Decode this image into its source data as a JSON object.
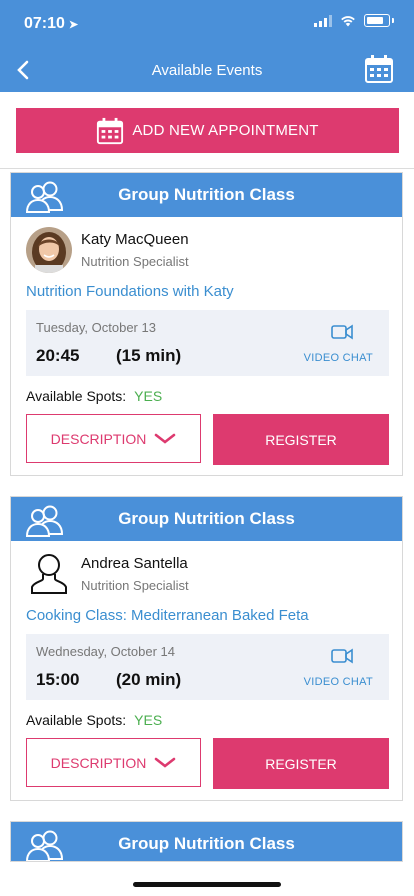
{
  "status_bar": {
    "time": "07:10"
  },
  "nav": {
    "title": "Available Events"
  },
  "add_button": {
    "label": "ADD NEW APPOINTMENT"
  },
  "events": [
    {
      "category": "Group Nutrition Class",
      "instructor": "Katy MacQueen",
      "role": "Nutrition Specialist",
      "name": "Nutrition Foundations with Katy",
      "date": "Tuesday, October 13",
      "time": "20:45",
      "duration": "(15 min)",
      "video_label": "VIDEO CHAT",
      "spots_label": "Available Spots:",
      "spots_value": "YES",
      "description_label": "DESCRIPTION",
      "register_label": "REGISTER"
    },
    {
      "category": "Group Nutrition Class",
      "instructor": "Andrea Santella",
      "role": "Nutrition Specialist",
      "name": "Cooking Class: Mediterranean Baked Feta",
      "date": "Wednesday, October 14",
      "time": "15:00",
      "duration": "(20 min)",
      "video_label": "VIDEO CHAT",
      "spots_label": "Available Spots:",
      "spots_value": "YES",
      "description_label": "DESCRIPTION",
      "register_label": "REGISTER"
    },
    {
      "category": "Group Nutrition Class"
    }
  ],
  "colors": {
    "header": "#4a90d9",
    "accent": "#dd3a6f",
    "link": "#3a8ed0",
    "success": "#4caf50"
  },
  "icons": [
    "back-arrow-icon",
    "calendar-icon",
    "group-icon",
    "video-camera-icon",
    "chevron-down-icon"
  ]
}
